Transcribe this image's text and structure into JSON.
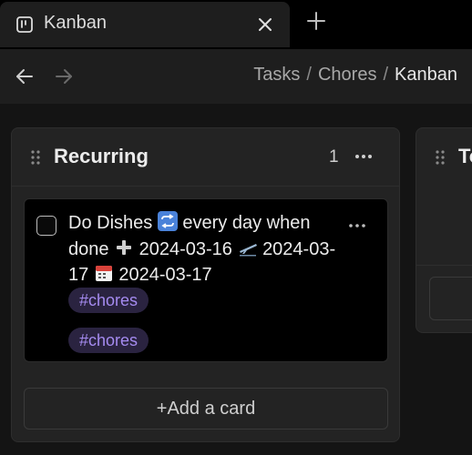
{
  "tab": {
    "title": "Kanban",
    "icon": "kanban-board-icon",
    "close_icon": "close-icon",
    "new_tab_icon": "plus-icon"
  },
  "nav": {
    "back_icon": "arrow-left-icon",
    "forward_icon": "arrow-right-icon",
    "breadcrumb": [
      "Tasks",
      "Chores",
      "Kanban"
    ],
    "separator": "/"
  },
  "board": {
    "lanes": [
      {
        "title": "Recurring",
        "count": "1",
        "menu_icon": "more-horizontal-icon",
        "cards": [
          {
            "checked": false,
            "text_parts": {
              "t1": "Do Dishes",
              "t2": "every day when done",
              "t3": "2024-03-16",
              "t4": "2024-03-17",
              "t5": "2024-03-17"
            },
            "emoji_icons": [
              "repeat-emoji-icon",
              "plus-emoji-icon",
              "airplane-departure-emoji-icon",
              "calendar-emoji-icon"
            ],
            "tags": [
              "#chores",
              "#chores"
            ]
          }
        ],
        "add_card_label": "+Add a card"
      },
      {
        "title": "To",
        "menu_icon": "grip-icon"
      }
    ]
  },
  "colors": {
    "background": "#000000",
    "panel": "#1e1e1e",
    "lane": "#232323",
    "tag_bg": "#2a2340",
    "tag_text": "#a58bf0"
  }
}
